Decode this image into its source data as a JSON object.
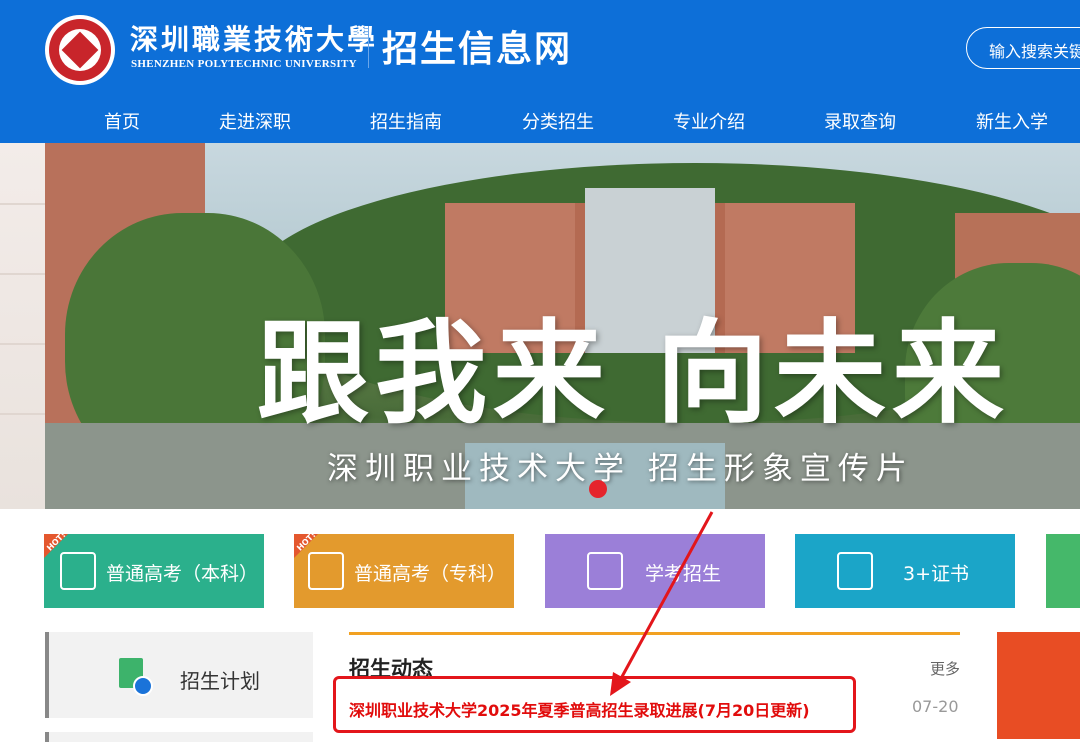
{
  "header": {
    "university_name_cn": "深圳職業技術大學",
    "university_name_en": "SHENZHEN POLYTECHNIC UNIVERSITY",
    "site_title": "招生信息网",
    "search_placeholder": "输入搜索关键",
    "brand_color": "#0d6fd8"
  },
  "nav": {
    "items": [
      {
        "label": "首页"
      },
      {
        "label": "走进深职"
      },
      {
        "label": "招生指南"
      },
      {
        "label": "分类招生"
      },
      {
        "label": "专业介绍"
      },
      {
        "label": "录取查询"
      },
      {
        "label": "新生入学"
      }
    ]
  },
  "banner": {
    "slogan": "跟我来 向未来",
    "subtitle": "深圳职业技术大学 招生形象宣传片",
    "active_slide": 1
  },
  "categories": [
    {
      "label": "普通高考（本科）",
      "color": "#2bb08c",
      "hot": true,
      "hot_label": "HOT!",
      "icon": "edit-doc-icon"
    },
    {
      "label": "普通高考（专科）",
      "color": "#e39a2d",
      "hot": true,
      "hot_label": "HOT!",
      "icon": "document-icon"
    },
    {
      "label": "学考招生",
      "color": "#9b7fd8",
      "hot": false,
      "icon": "id-card-icon"
    },
    {
      "label": "3+证书",
      "color": "#1ba5c8",
      "hot": false,
      "icon": "building-icon"
    },
    {
      "label": "",
      "color": "#45b86a",
      "hot": false,
      "icon": ""
    }
  ],
  "sidebar": {
    "items": [
      {
        "label": "招生计划",
        "icon": "plan-doc-icon"
      }
    ]
  },
  "news": {
    "title": "招生动态",
    "more_label": "更多",
    "items": [
      {
        "title": "深圳职业技术大学2025年夏季普高招生录取进展(7月20日更新)",
        "date": "07-20",
        "highlighted": true
      }
    ],
    "accent_color": "#f2a121",
    "highlight_color": "#e10c0c"
  }
}
